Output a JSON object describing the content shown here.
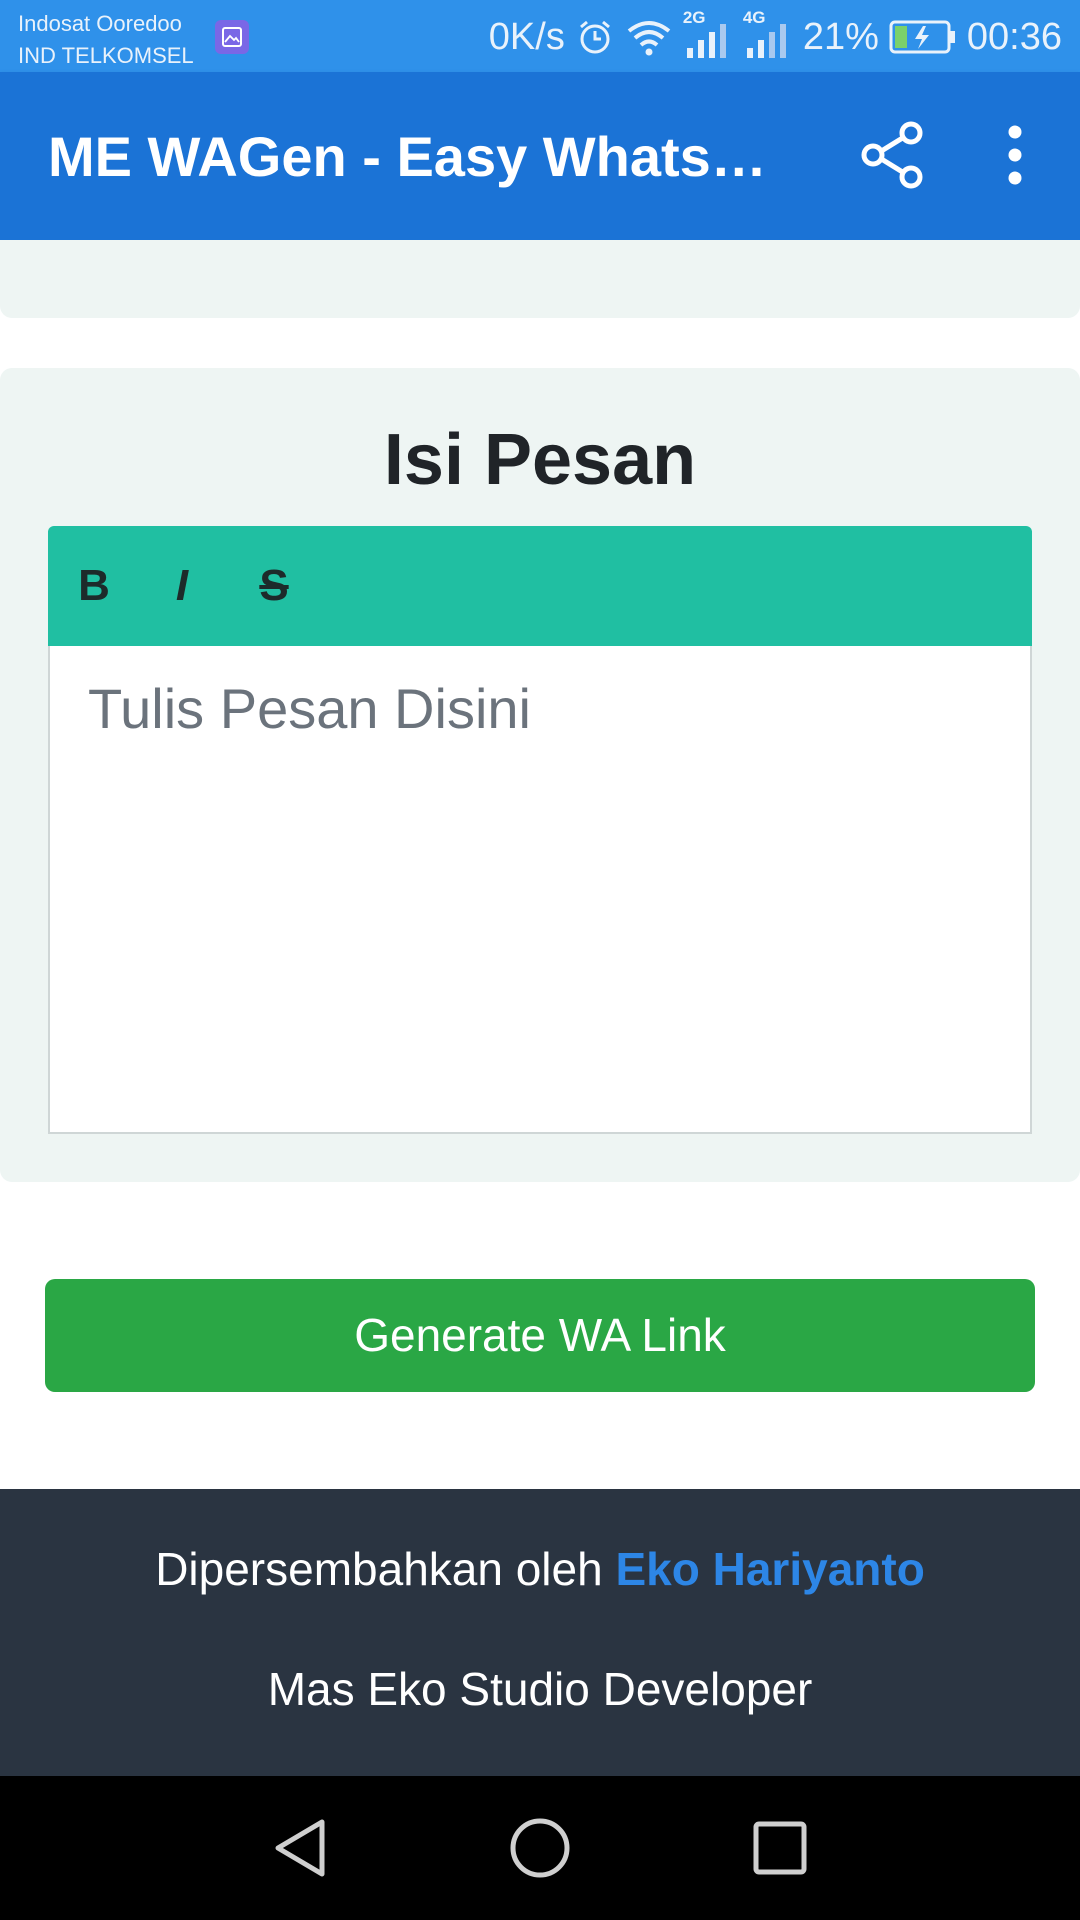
{
  "status_bar": {
    "carrier_1": "Indosat Ooredoo",
    "carrier_2": "IND TELKOMSEL",
    "net_speed": "0K/s",
    "signal_1_tag": "2G",
    "signal_2_tag": "4G",
    "battery": "21%",
    "time": "00:36",
    "icons": [
      "image-notification-icon",
      "alarm-icon",
      "wifi-icon",
      "signal-icon",
      "battery-charging-icon"
    ]
  },
  "app_bar": {
    "title": "ME WAGen - Easy WhatsApp Link Generator",
    "icons": [
      "share-icon",
      "more-vert-icon"
    ]
  },
  "message_section": {
    "title": "Isi Pesan",
    "toolbar": {
      "bold": "B",
      "italic": "I",
      "strike": "S"
    },
    "editor_placeholder": "Tulis Pesan Disini"
  },
  "generate_button": {
    "label": "Generate WA Link"
  },
  "footer": {
    "prefix": "Dipersembahkan oleh ",
    "author": "Eko Hariyanto",
    "studio": "Mas Eko Studio Developer"
  },
  "colors": {
    "status_bar": "#2f91ea",
    "app_bar": "#1b73d6",
    "toolbar": "#20bfa2",
    "generate_button": "#2aa745",
    "footer": "#2a3441",
    "link": "#2d86e6"
  }
}
